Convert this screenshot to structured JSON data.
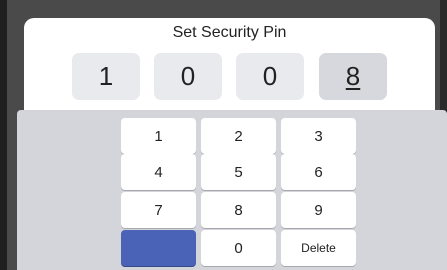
{
  "dialog": {
    "title": "Set Security Pin",
    "pin_digits": [
      "1",
      "0",
      "0",
      "8"
    ],
    "active_digit_index": 3
  },
  "keypad": {
    "keys": [
      "1",
      "2",
      "3",
      "4",
      "5",
      "6",
      "7",
      "8",
      "9",
      "",
      "0",
      "Delete"
    ]
  },
  "colors": {
    "accent": "#4a63b6",
    "keyboard_bg": "#d3d5da",
    "digit_bg": "#e9eaed"
  }
}
